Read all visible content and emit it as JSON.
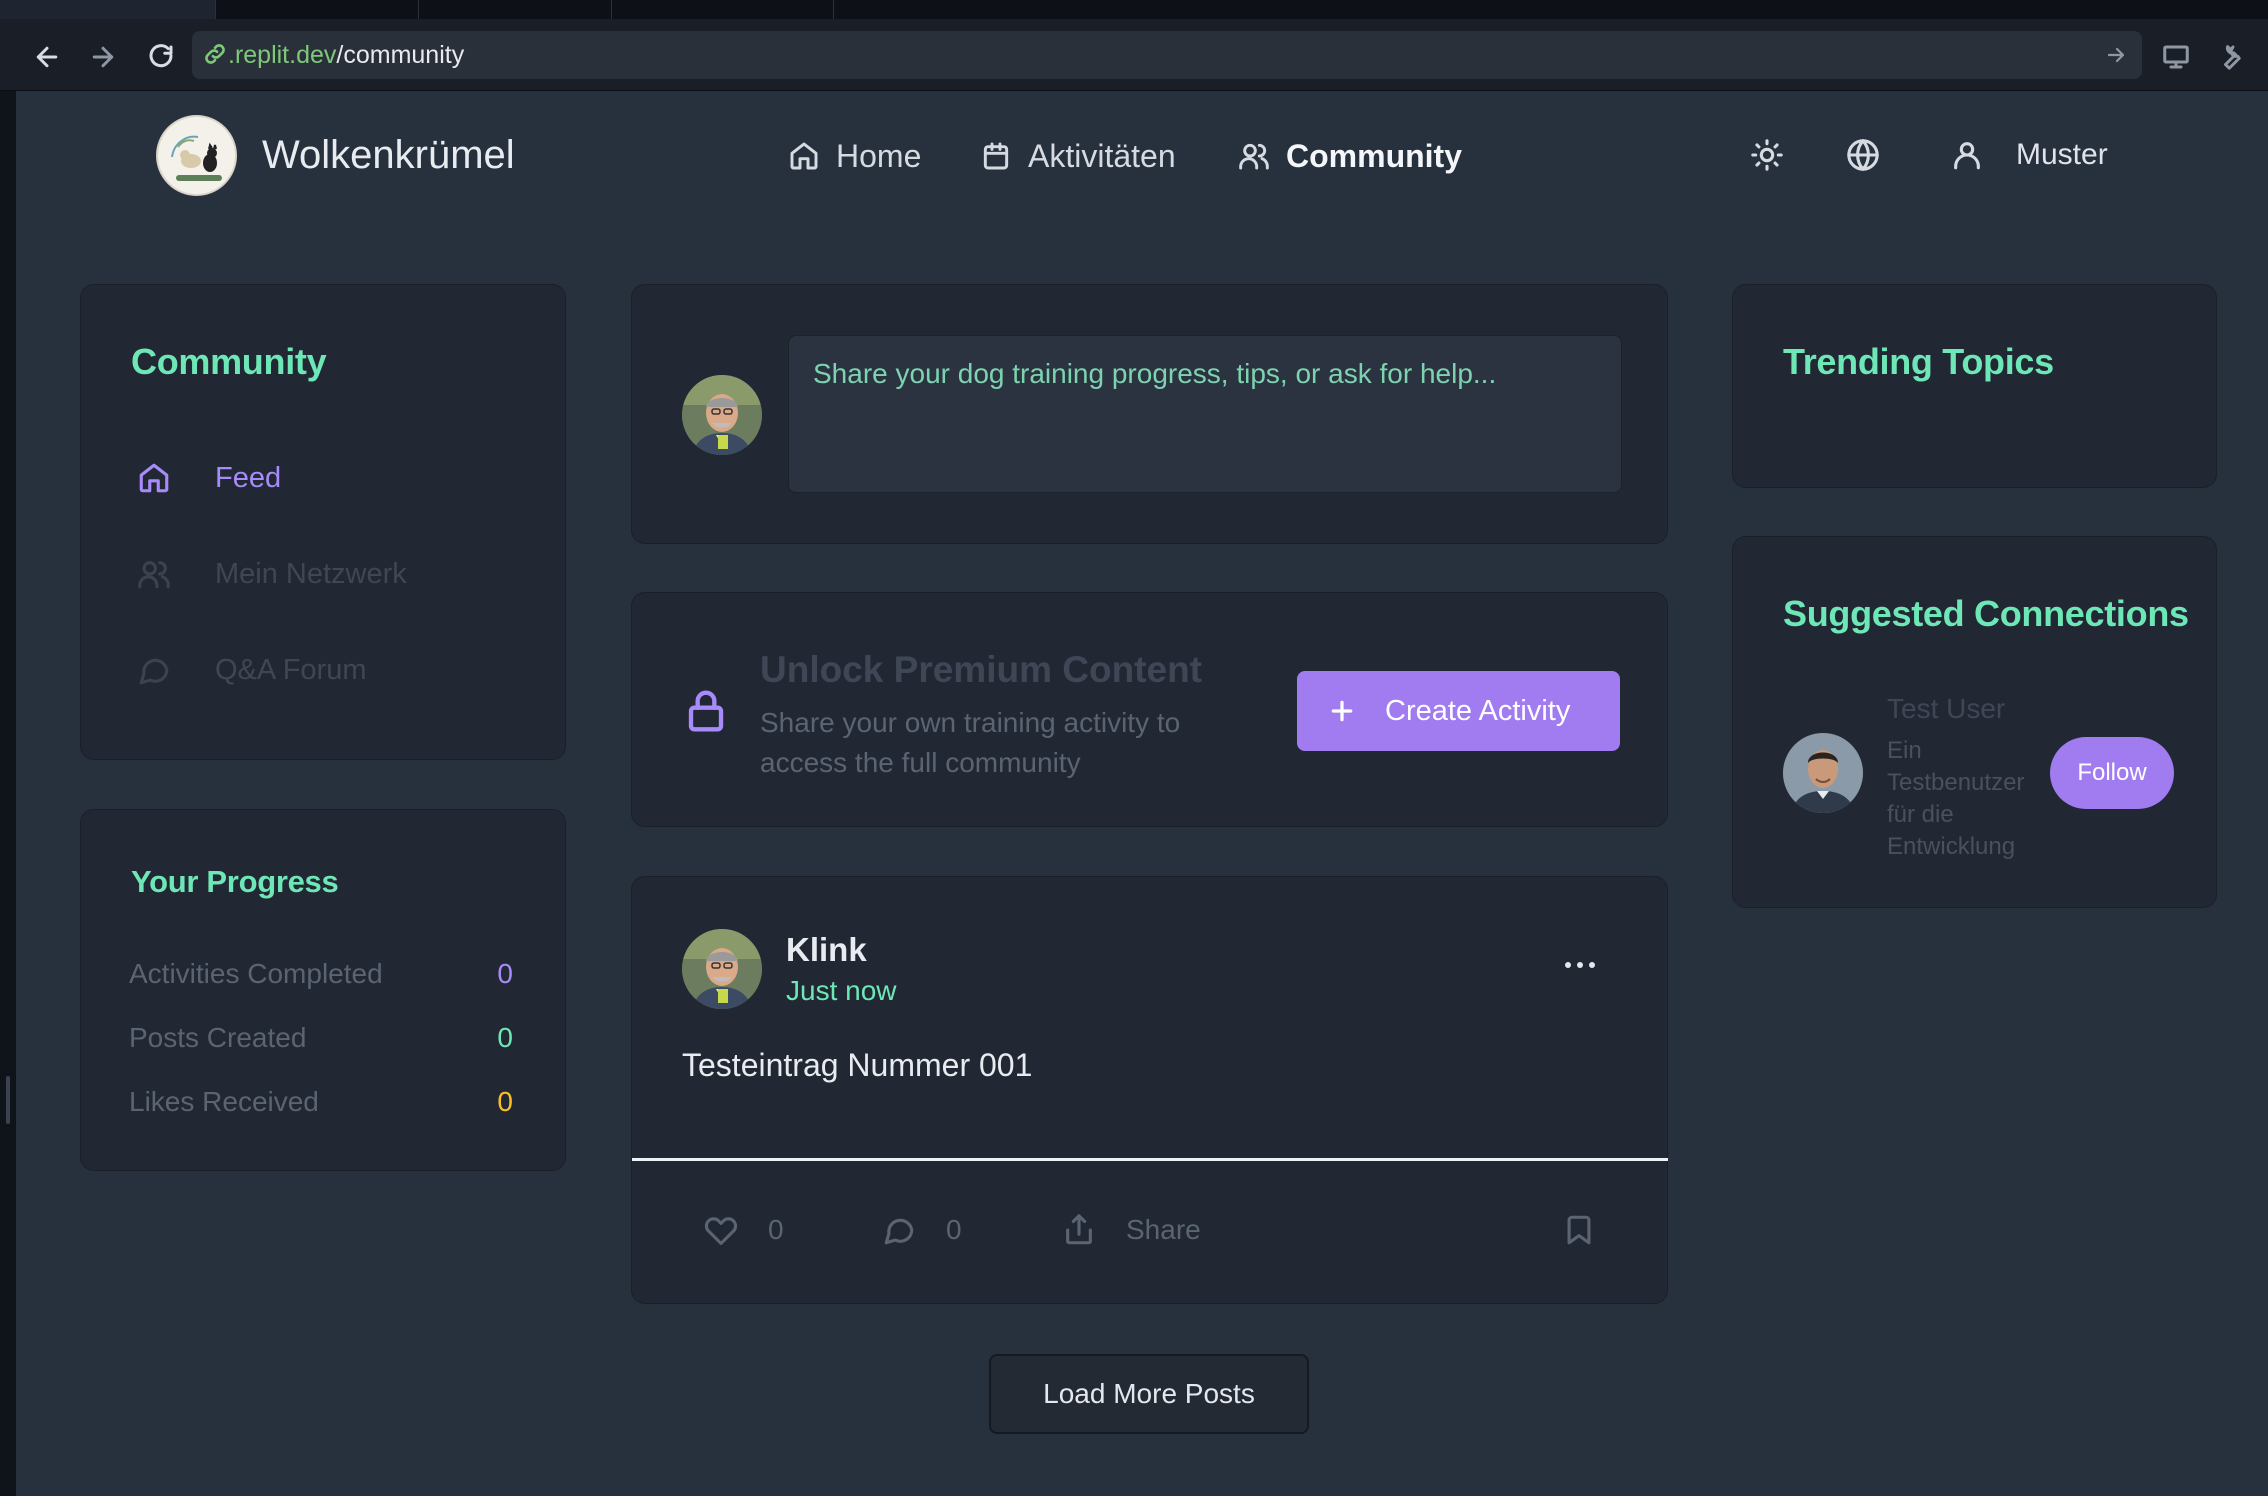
{
  "browser": {
    "url_host": ".replit.dev",
    "url_path": "/community"
  },
  "header": {
    "brand": "Wolkenkrümel",
    "nav": {
      "home": "Home",
      "activities": "Aktivitäten",
      "community": "Community"
    },
    "user_name": "Muster"
  },
  "sidebar": {
    "title": "Community",
    "items": [
      {
        "label": "Feed",
        "icon": "home-icon",
        "active": true
      },
      {
        "label": "Mein Netzwerk",
        "icon": "users-icon",
        "active": false
      },
      {
        "label": "Q&A Forum",
        "icon": "chat-bubble-icon",
        "active": false
      }
    ]
  },
  "progress": {
    "title": "Your Progress",
    "rows": [
      {
        "label": "Activities Completed",
        "value": "0",
        "color": "#a78bfa"
      },
      {
        "label": "Posts Created",
        "value": "0",
        "color": "#6ee7b7"
      },
      {
        "label": "Likes Received",
        "value": "0",
        "color": "#fbbf24"
      }
    ]
  },
  "composer": {
    "placeholder": "Share your dog training progress, tips, or ask for help..."
  },
  "premium": {
    "title": "Unlock Premium Content",
    "description": "Share your own training activity to access the full community",
    "button": "Create Activity"
  },
  "post": {
    "author": "Klink",
    "time": "Just now",
    "content": "Testeintrag Nummer 001",
    "likes": "0",
    "comments": "0",
    "share_label": "Share"
  },
  "load_more": "Load More Posts",
  "trending": {
    "title": "Trending Topics"
  },
  "suggested": {
    "title": "Suggested Connections",
    "users": [
      {
        "name": "Test User",
        "bio": "Ein Testbenutzer für die Entwicklung",
        "button": "Follow"
      }
    ]
  },
  "colors": {
    "accent_green": "#6ee7b7",
    "accent_purple": "#a78bfa",
    "accent_yellow": "#fbbf24",
    "background": "#27303d",
    "card": "#222833"
  }
}
